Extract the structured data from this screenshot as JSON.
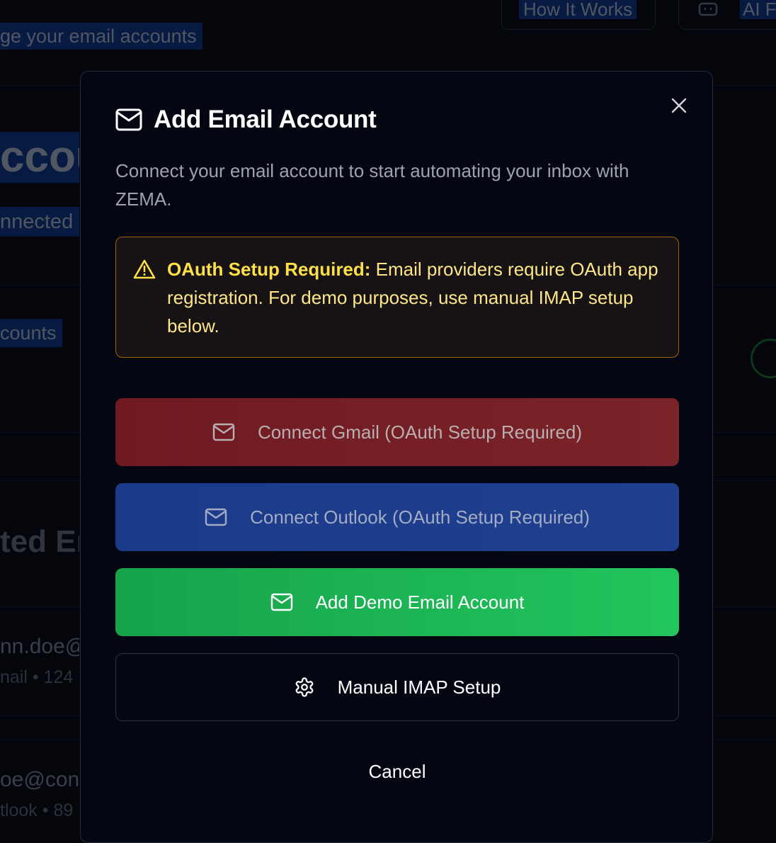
{
  "background": {
    "nav_how_it_works": "How It Works",
    "nav_ai": "AI F",
    "subtitle_fragment": "ge your email accounts",
    "heading_fragment": "ccou",
    "connected_fragment": "nnected",
    "accounts_fragment": "counts",
    "section_fragment": "ted Er",
    "account1_email_fragment": "nn.doe@",
    "account1_meta_fragment": "nail • 124",
    "account2_email_fragment": "oe@con",
    "account2_meta_fragment": "tlook • 89"
  },
  "modal": {
    "title": "Add Email Account",
    "title_icon": "mail-icon",
    "description": "Connect your email account to start automating your inbox with ZEMA.",
    "warning": {
      "icon": "alert-triangle-icon",
      "label": "OAuth Setup Required:",
      "text": " Email providers require OAuth app registration. For demo purposes, use manual IMAP setup below."
    },
    "buttons": {
      "gmail": "Connect Gmail (OAuth Setup Required)",
      "outlook": "Connect Outlook (OAuth Setup Required)",
      "demo": "Add Demo Email Account",
      "imap": "Manual IMAP Setup"
    },
    "cancel": "Cancel"
  },
  "colors": {
    "gmail_button": "#6f1a22",
    "outlook_button": "#1b3a8a",
    "demo_button": "#22c55e",
    "warning_border": "#a16207",
    "warning_text": "#fde047"
  }
}
